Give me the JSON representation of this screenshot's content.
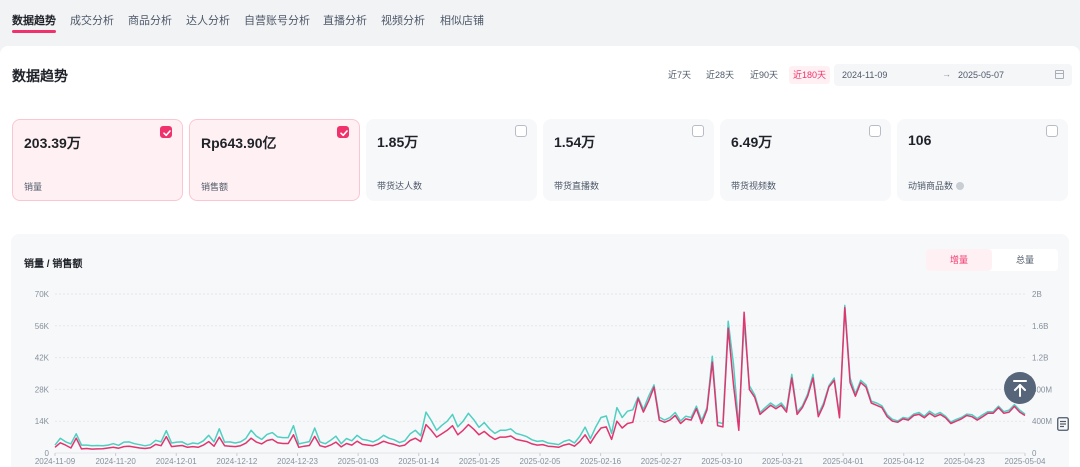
{
  "nav": {
    "tabs": [
      "数据趋势",
      "成交分析",
      "商品分析",
      "达人分析",
      "自营账号分析",
      "直播分析",
      "视频分析",
      "相似店铺"
    ],
    "active_index": 0
  },
  "section": {
    "title": "数据趋势",
    "ranges": [
      "近7天",
      "近28天",
      "近90天",
      "近180天"
    ],
    "active_range": "近180天",
    "date_start": "2024-11-09",
    "date_separator": "→",
    "date_end": "2025-05-07"
  },
  "metrics": [
    {
      "value": "203.39万",
      "label": "销量",
      "selected": true
    },
    {
      "value": "Rp643.90亿",
      "label": "销售额",
      "selected": true
    },
    {
      "value": "1.85万",
      "label": "带货达人数",
      "selected": false
    },
    {
      "value": "1.54万",
      "label": "带货直播数",
      "selected": false
    },
    {
      "value": "6.49万",
      "label": "带货视频数",
      "selected": false
    },
    {
      "value": "106",
      "label": "动销商品数",
      "selected": false,
      "info": true
    }
  ],
  "chart_panel": {
    "title": "销量 / 销售额",
    "toggle": [
      "增量",
      "总量"
    ],
    "active_toggle": "增量"
  },
  "colors": {
    "accent": "#f0326c",
    "sales_volume_line": "#e0356e",
    "sales_amount_line": "#4fcfc2"
  },
  "icons": {
    "back_to_top": "arrow-up-icon",
    "side": "document-icon",
    "calendar": "calendar-icon",
    "checkbox": "check-icon"
  },
  "chart_data": {
    "type": "line",
    "title": "",
    "xlabel": "",
    "ylabel": "",
    "x_tick_labels": [
      "2024-11-09",
      "2024-11-20",
      "2024-12-01",
      "2024-12-12",
      "2024-12-23",
      "2025-01-03",
      "2025-01-14",
      "2025-01-25",
      "2025-02-05",
      "2025-02-16",
      "2025-02-27",
      "2025-03-10",
      "2025-03-21",
      "2025-04-01",
      "2025-04-12",
      "2025-04-23",
      "2025-05-04"
    ],
    "y_left_ticks": [
      "0",
      "14K",
      "28K",
      "42K",
      "56K",
      "70K"
    ],
    "y_left_lim": [
      0,
      70000
    ],
    "y_right_ticks": [
      "0",
      "400M",
      "800M",
      "1.2B",
      "1.6B",
      "2B"
    ],
    "y_right_lim": [
      0,
      2000000000
    ],
    "grid": true,
    "series": [
      {
        "axis": "left",
        "color": "#e0356e",
        "values": [
          2500,
          4500,
          3500,
          2200,
          6500,
          1800,
          2000,
          1700,
          1800,
          1900,
          2200,
          2500,
          2100,
          2800,
          3000,
          2600,
          2200,
          2000,
          2300,
          3800,
          3200,
          7200,
          2800,
          3100,
          3300,
          2500,
          2800,
          2500,
          3500,
          5000,
          3000,
          7000,
          3200,
          3000,
          2800,
          3200,
          4300,
          6500,
          4800,
          4000,
          5500,
          6000,
          4500,
          4200,
          4200,
          8000,
          2500,
          3000,
          3300,
          7300,
          3200,
          2600,
          3500,
          4800,
          2700,
          4200,
          3500,
          5200,
          3800,
          3500,
          3200,
          4000,
          5200,
          4300,
          3800,
          3000,
          3500,
          5500,
          6500,
          5000,
          12500,
          10000,
          7000,
          8500,
          10000,
          12000,
          8000,
          10000,
          12500,
          10500,
          8000,
          9500,
          7500,
          6000,
          7000,
          7000,
          7500,
          6000,
          5500,
          5000,
          4000,
          3500,
          3700,
          3000,
          2800,
          2500,
          3500,
          4000,
          3000,
          5000,
          8000,
          4300,
          8000,
          11000,
          11500,
          6000,
          14000,
          11000,
          13000,
          13500,
          24000,
          18000,
          23000,
          29000,
          14500,
          13500,
          14500,
          16500,
          13000,
          15000,
          14500,
          19500,
          13000,
          19000,
          40000,
          12000,
          11500,
          55000,
          30000,
          10000,
          62000,
          28000,
          24500,
          17000,
          19000,
          21000,
          19500,
          21000,
          18000,
          33000,
          17000,
          20000,
          25000,
          33000,
          16000,
          21000,
          29000,
          32000,
          15500,
          64000,
          31000,
          25000,
          31000,
          29000,
          22000,
          21000,
          20000,
          16000,
          14000,
          13500,
          15000,
          14500,
          16500,
          17000,
          15500,
          17500,
          16000,
          17000,
          15500,
          13000,
          14000,
          15000,
          16500,
          16000,
          14500,
          16000,
          17500,
          17500,
          20000,
          17500,
          18000,
          20500,
          18000,
          16500
        ]
      },
      {
        "axis": "right",
        "color": "#4fcfc2",
        "values": [
          100000000,
          185000000,
          141000000,
          114000000,
          242000000,
          100000000,
          100000000,
          91000000,
          94000000,
          91000000,
          100000000,
          117000000,
          97000000,
          137000000,
          140000000,
          117000000,
          105000000,
          91000000,
          105000000,
          160000000,
          140000000,
          280000000,
          126000000,
          137000000,
          140000000,
          105000000,
          126000000,
          117000000,
          154000000,
          223000000,
          140000000,
          305000000,
          137000000,
          140000000,
          126000000,
          140000000,
          183000000,
          285000000,
          211000000,
          171000000,
          234000000,
          257000000,
          203000000,
          194000000,
          194000000,
          343000000,
          114000000,
          129000000,
          143000000,
          314000000,
          140000000,
          117000000,
          160000000,
          211000000,
          117000000,
          183000000,
          154000000,
          223000000,
          171000000,
          160000000,
          140000000,
          171000000,
          223000000,
          186000000,
          166000000,
          131000000,
          154000000,
          240000000,
          286000000,
          217000000,
          514000000,
          409000000,
          286000000,
          349000000,
          400000000,
          486000000,
          329000000,
          400000000,
          500000000,
          420000000,
          323000000,
          383000000,
          303000000,
          246000000,
          286000000,
          286000000,
          303000000,
          246000000,
          229000000,
          206000000,
          166000000,
          146000000,
          154000000,
          126000000,
          117000000,
          106000000,
          146000000,
          166000000,
          126000000,
          209000000,
          326000000,
          180000000,
          326000000,
          446000000,
          466000000,
          246000000,
          571000000,
          446000000,
          526000000,
          543000000,
          703000000,
          549000000,
          714000000,
          857000000,
          451000000,
          414000000,
          446000000,
          509000000,
          403000000,
          463000000,
          446000000,
          589000000,
          409000000,
          571000000,
          1217000000,
          386000000,
          371000000,
          1657000000,
          1114000000,
          320000000,
          1646000000,
          846000000,
          731000000,
          509000000,
          571000000,
          629000000,
          583000000,
          629000000,
          543000000,
          989000000,
          514000000,
          594000000,
          743000000,
          989000000,
          486000000,
          629000000,
          846000000,
          943000000,
          463000000,
          1857000000,
          943000000,
          743000000,
          914000000,
          857000000,
          651000000,
          629000000,
          594000000,
          480000000,
          423000000,
          403000000,
          446000000,
          434000000,
          489000000,
          509000000,
          463000000,
          526000000,
          480000000,
          509000000,
          463000000,
          389000000,
          423000000,
          446000000,
          489000000,
          480000000,
          434000000,
          480000000,
          520000000,
          520000000,
          589000000,
          520000000,
          540000000,
          609000000,
          540000000,
          489000000
        ]
      }
    ]
  }
}
